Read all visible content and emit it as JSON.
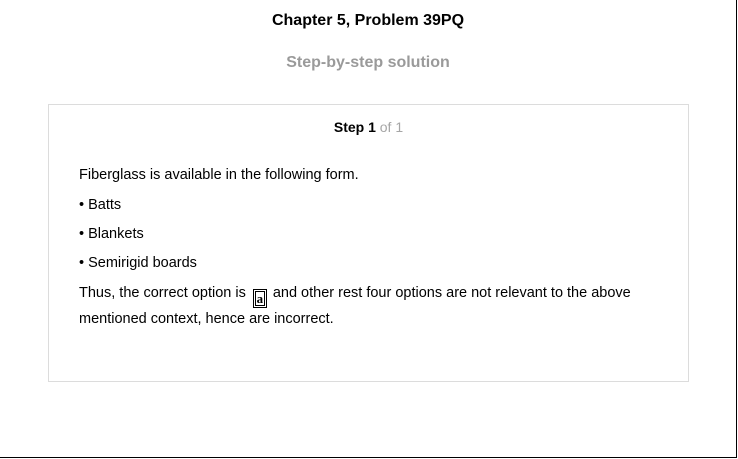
{
  "header": {
    "title": "Chapter 5, Problem 39PQ",
    "subtitle": "Step-by-step solution"
  },
  "step": {
    "label": "Step 1",
    "of": "of 1"
  },
  "solution": {
    "intro": "Fiberglass is available in the following form.",
    "bullets": [
      "• Batts",
      "• Blankets",
      "• Semirigid boards"
    ],
    "conclusion_before": "Thus, the correct option is",
    "answer": "a",
    "conclusion_after": "and other rest four options are not relevant to the above",
    "conclusion_line2": "mentioned context, hence are incorrect."
  }
}
